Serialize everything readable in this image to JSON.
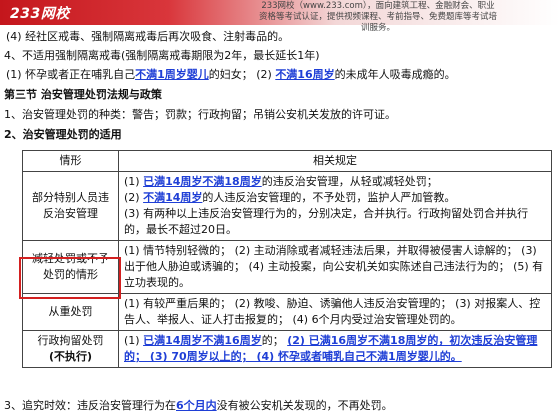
{
  "banner": {
    "logo": "233网校",
    "tagline": "233网校（www.233.com），面向建筑工程、金融财会、职业资格等考试认证，提供视频课程、考前指导、免费题库等考试培训服务。"
  },
  "lines": {
    "l1": "(4) 经社区戒毒、强制隔离戒毒后再次吸食、注射毒品的。",
    "l2": "4、不适用强制隔离戒毒(强制隔离戒毒期限为2年，最长延长1年)",
    "l3_a": "(1) 怀孕或者正在哺乳自己",
    "l3_b": "不满1周岁婴儿",
    "l3_c": "的妇女；  (2) ",
    "l3_d": "不满16周岁",
    "l3_e": "的未成年人吸毒成瘾的。",
    "section": "第三节  治安管理处罚法规与政策",
    "l4": "1、治安管理处罚的种类：警告；罚款；行政拘留；吊销公安机关发放的许可证。",
    "l5": "2、治安管理处罚的适用",
    "bottom_a": "3、追究时效：违反治安管理行为在",
    "bottom_b": "6个月内",
    "bottom_c": "没有被公安机关发现的，不再处罚。"
  },
  "table": {
    "col1_header": "情形",
    "col2_header": "相关规定",
    "r1": {
      "label": "部分特别人员违反治安管理",
      "a1": "(1) ",
      "a2": "已满14周岁不满18周岁",
      "a3": "的违反治安管理，从轻或减轻处罚；",
      "b1": "(2) ",
      "b2": "不满14周岁",
      "b3": "的人违反治安管理的，不予处罚，监护人严加管教。",
      "c": "(3) 有两种以上违反治安管理行为的，分别决定，合并执行。行政拘留处罚合并执行的，最长不超过20日。"
    },
    "r2": {
      "label": "减轻处罚或不予处罚的情形",
      "text": "(1) 情节特别轻微的；  (2) 主动消除或者减轻违法后果，并取得被侵害人谅解的；  (3) 出于他人胁迫或诱骗的；  (4) 主动投案，向公安机关如实陈述自己违法行为的；  (5) 有立功表现的。"
    },
    "r3": {
      "label": "从重处罚",
      "text": "(1) 有较严重后果的；  (2) 教唆、胁迫、诱骗他人违反治安管理的；  (3) 对报案人、控告人、举报人、证人打击报复的；  (4) 6个月内受过治安管理处罚的。"
    },
    "r4": {
      "label_a": "行政拘留处罚",
      "label_b": "(不执行)",
      "p1": "(1) ",
      "p2": "已满14周岁不满16周岁",
      "p3": "的；  ",
      "p4": "(2) 已满16周岁不满18周岁的，初次违反治安管理的；  (3) 70周岁以上的；  (4) 怀孕或者哺乳自己不满1周岁婴儿的。"
    }
  }
}
